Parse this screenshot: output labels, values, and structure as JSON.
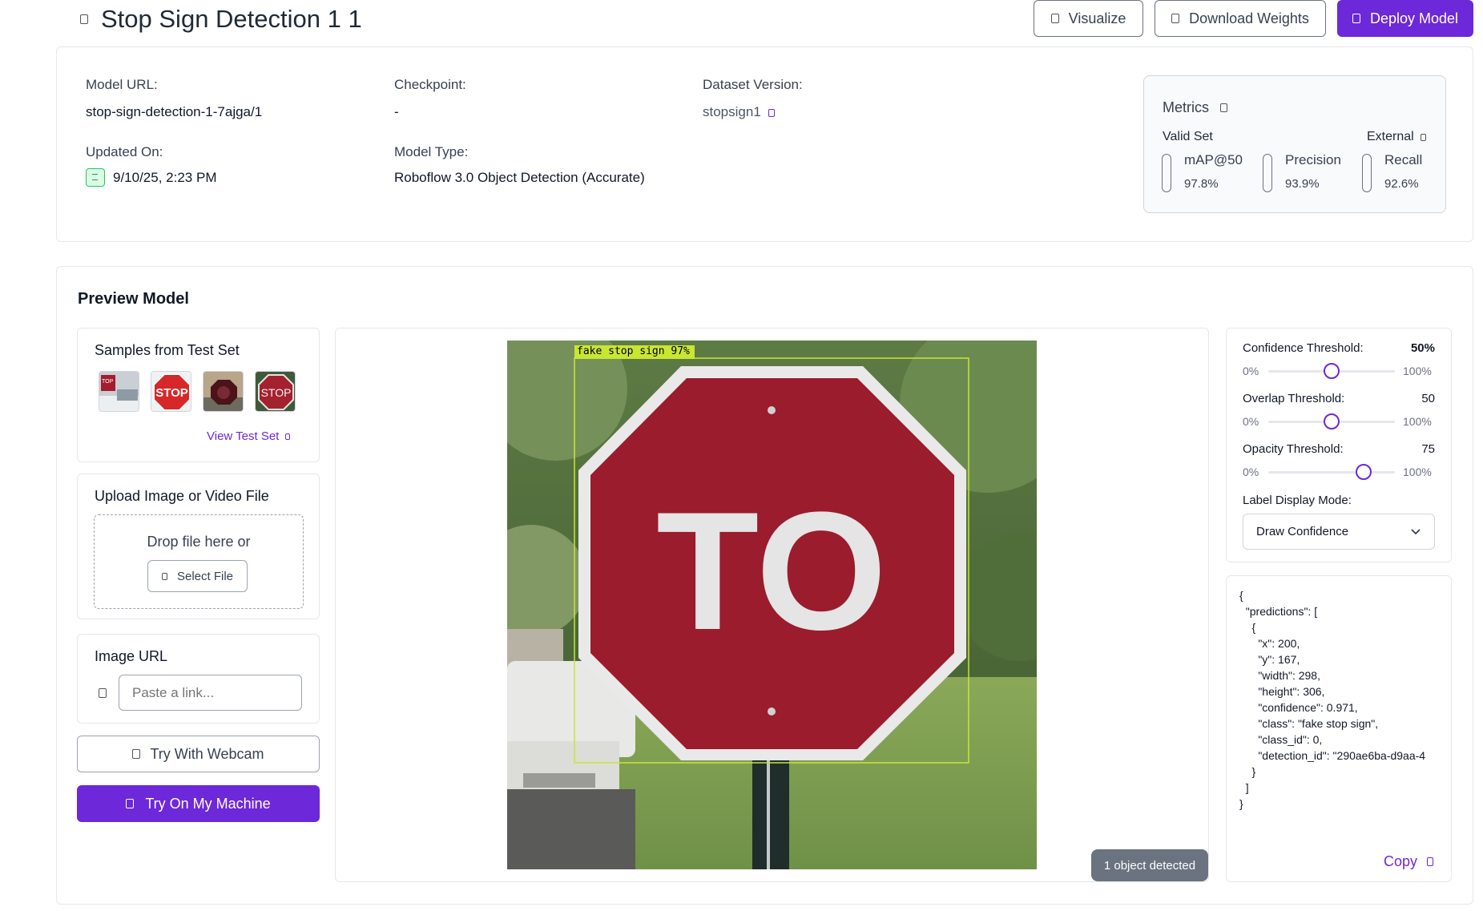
{
  "header": {
    "title": "Stop Sign Detection 1 1",
    "buttons": {
      "visualize": "Visualize",
      "download": "Download Weights",
      "deploy": "Deploy Model"
    }
  },
  "info": {
    "model_url_label": "Model URL:",
    "model_url_value": "stop-sign-detection-1-7ajga/1",
    "checkpoint_label": "Checkpoint:",
    "checkpoint_value": "-",
    "dataset_version_label": "Dataset Version:",
    "dataset_version_value": "stopsign1",
    "updated_label": "Updated On:",
    "updated_value": "9/10/25, 2:23 PM",
    "model_type_label": "Model Type:",
    "model_type_value": "Roboflow 3.0 Object Detection (Accurate)"
  },
  "metrics": {
    "title": "Metrics",
    "valid_set": "Valid Set",
    "external": "External",
    "items": [
      {
        "name": "mAP@50",
        "value": "97.8%"
      },
      {
        "name": "Precision",
        "value": "93.9%"
      },
      {
        "name": "Recall",
        "value": "92.6%"
      }
    ]
  },
  "preview": {
    "title": "Preview Model",
    "samples_title": "Samples from Test Set",
    "view_test_set": "View Test Set",
    "upload_title": "Upload Image or Video File",
    "drop_text": "Drop file here or",
    "select_file": "Select File",
    "image_url_title": "Image URL",
    "image_url_placeholder": "Paste a link...",
    "webcam": "Try With Webcam",
    "my_machine": "Try On My Machine",
    "detection_label": "fake stop sign 97%",
    "objects_detected": "1 object detected"
  },
  "controls": {
    "confidence": {
      "label": "Confidence Threshold:",
      "value": "50%",
      "min": "0%",
      "max": "100%",
      "level": 0.5
    },
    "overlap": {
      "label": "Overlap Threshold:",
      "value": "50",
      "min": "0%",
      "max": "100%",
      "level": 0.5
    },
    "opacity": {
      "label": "Opacity Threshold:",
      "value": "75",
      "min": "0%",
      "max": "100%",
      "level": 0.75
    },
    "label_mode_label": "Label Display Mode:",
    "label_mode_value": "Draw Confidence"
  },
  "json_output": "{\n  \"predictions\": [\n    {\n      \"x\": 200,\n      \"y\": 167,\n      \"width\": 298,\n      \"height\": 306,\n      \"confidence\": 0.971,\n      \"class\": \"fake stop sign\",\n      \"class_id\": 0,\n      \"detection_id\": \"290ae6ba-d9aa-4\n    }\n  ]\n}",
  "copy_label": "Copy",
  "colors": {
    "accent": "#6d28d9",
    "bbox": "#c8e632",
    "sign_red": "#9b1c2c"
  }
}
